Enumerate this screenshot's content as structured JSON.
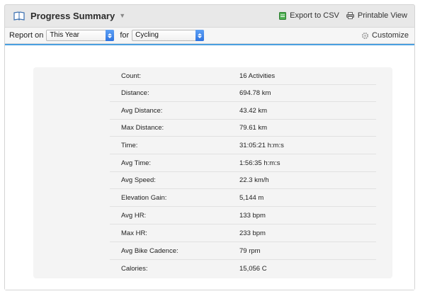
{
  "header": {
    "title": "Progress Summary",
    "export_label": "Export to CSV",
    "print_label": "Printable View"
  },
  "toolbar": {
    "report_on_label": "Report on",
    "period_value": "This Year",
    "for_label": "for",
    "activity_value": "Cycling",
    "customize_label": "Customize"
  },
  "summary": [
    {
      "label": "Count:",
      "value": "16 Activities"
    },
    {
      "label": "Distance:",
      "value": "694.78 km"
    },
    {
      "label": "Avg Distance:",
      "value": "43.42 km"
    },
    {
      "label": "Max Distance:",
      "value": "79.61 km"
    },
    {
      "label": "Time:",
      "value": "31:05:21 h:m:s"
    },
    {
      "label": "Avg Time:",
      "value": "1:56:35 h:m:s"
    },
    {
      "label": "Avg Speed:",
      "value": "22.3 km/h"
    },
    {
      "label": "Elevation Gain:",
      "value": "5,144 m"
    },
    {
      "label": "Avg HR:",
      "value": "133 bpm"
    },
    {
      "label": "Max HR:",
      "value": "233 bpm"
    },
    {
      "label": "Avg Bike Cadence:",
      "value": "79 rpm"
    },
    {
      "label": "Calories:",
      "value": "15,056 C"
    }
  ],
  "icons": {
    "header": "book-icon",
    "export": "csv-file-icon",
    "print": "printer-icon",
    "customize": "gear-icon"
  },
  "colors": {
    "accent": "#4aa0e0",
    "select_arrow": "#3b82e8",
    "csv_green": "#4caf50"
  }
}
